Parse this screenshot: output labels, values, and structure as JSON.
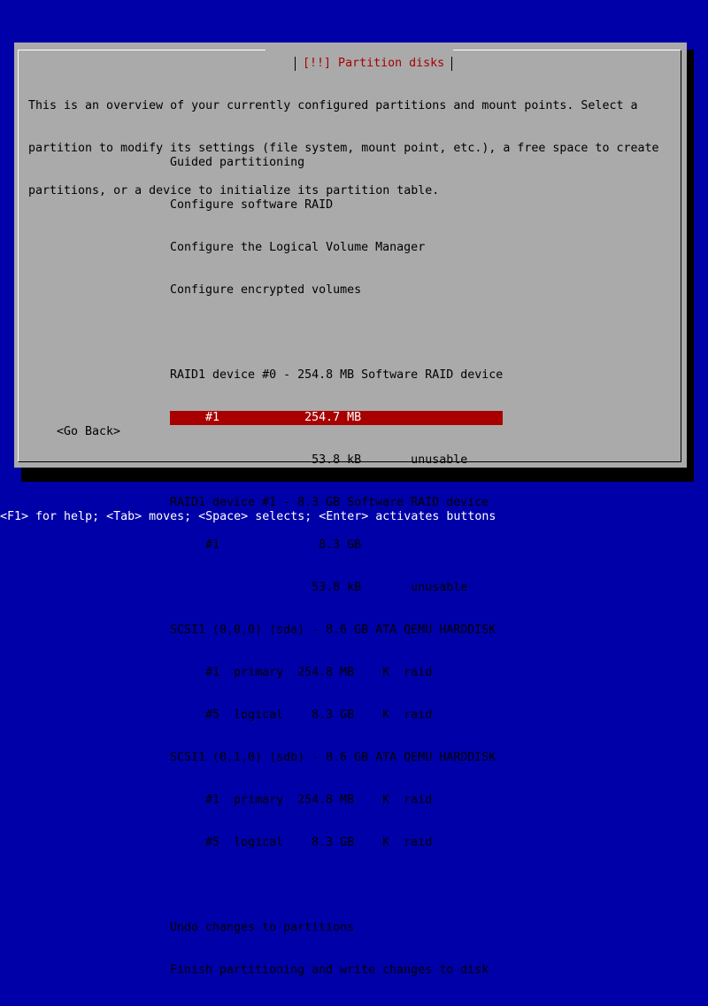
{
  "dialog": {
    "title": "[!!] Partition disks",
    "intro_lines": [
      "This is an overview of your currently configured partitions and mount points. Select a",
      "partition to modify its settings (file system, mount point, etc.), a free space to create",
      "partitions, or a device to initialize its partition table."
    ]
  },
  "menu": {
    "items": [
      "Guided partitioning",
      "Configure software RAID",
      "Configure the Logical Volume Manager",
      "Configure encrypted volumes",
      "",
      "RAID1 device #0 - 254.8 MB Software RAID device",
      "     #1            254.7 MB",
      "                    53.8 kB       unusable",
      "RAID1 device #1 - 8.3 GB Software RAID device",
      "     #1              8.3 GB",
      "                    53.8 kB       unusable",
      "SCSI1 (0,0,0) (sda) - 8.6 GB ATA QEMU HARDDISK",
      "     #1  primary  254.8 MB    K  raid",
      "     #5  logical    8.3 GB    K  raid",
      "SCSI1 (0,1,0) (sdb) - 8.6 GB ATA QEMU HARDDISK",
      "     #1  primary  254.8 MB    K  raid",
      "     #5  logical    8.3 GB    K  raid",
      "",
      "Undo changes to partitions",
      "Finish partitioning and write changes to disk"
    ],
    "selected_index": 6
  },
  "buttons": {
    "go_back": "<Go Back>"
  },
  "status_bar": {
    "text": "<F1> for help; <Tab> moves; <Space> selects; <Enter> activates buttons"
  },
  "colors": {
    "background": "#0000a8",
    "dialog": "#aaaaaa",
    "title": "#a80000",
    "selection": "#a80000",
    "status_text": "#ffffff"
  }
}
